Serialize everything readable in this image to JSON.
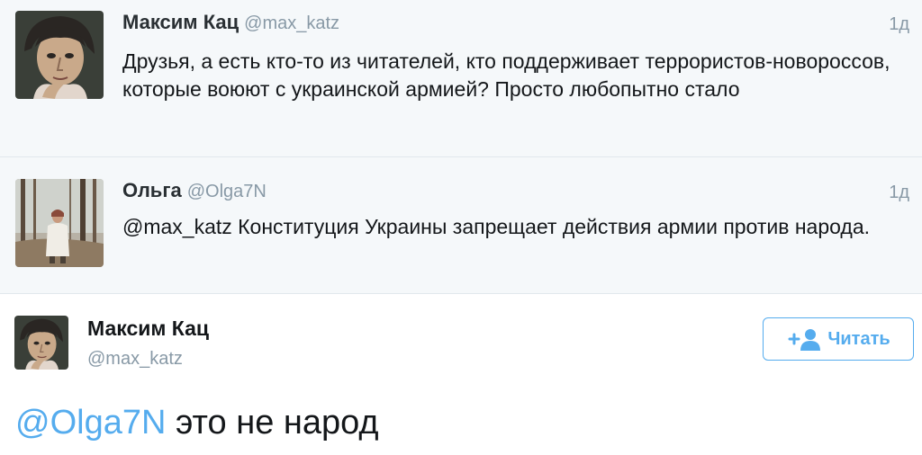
{
  "tweets": [
    {
      "author": "Максим Кац",
      "handle": "@max_katz",
      "time": "1д",
      "text": "Друзья, а есть кто-то из читателей, кто поддерживает террористов-новороссов, которые воюют с украинской армией? Просто любопытно стало"
    },
    {
      "author": "Ольга",
      "handle": "@Olga7N",
      "time": "1д",
      "text": "@max_katz Конституция Украины запрещает действия армии против народа."
    }
  ],
  "main": {
    "author": "Максим Кац",
    "handle": "@max_katz",
    "follow_label": "Читать",
    "mention": "@Olga7N",
    "text": " это не народ"
  },
  "colors": {
    "link": "#55acee",
    "muted": "#8899a6",
    "divider": "#e1e8ed"
  },
  "icons": {
    "follow": "add-user-icon"
  }
}
